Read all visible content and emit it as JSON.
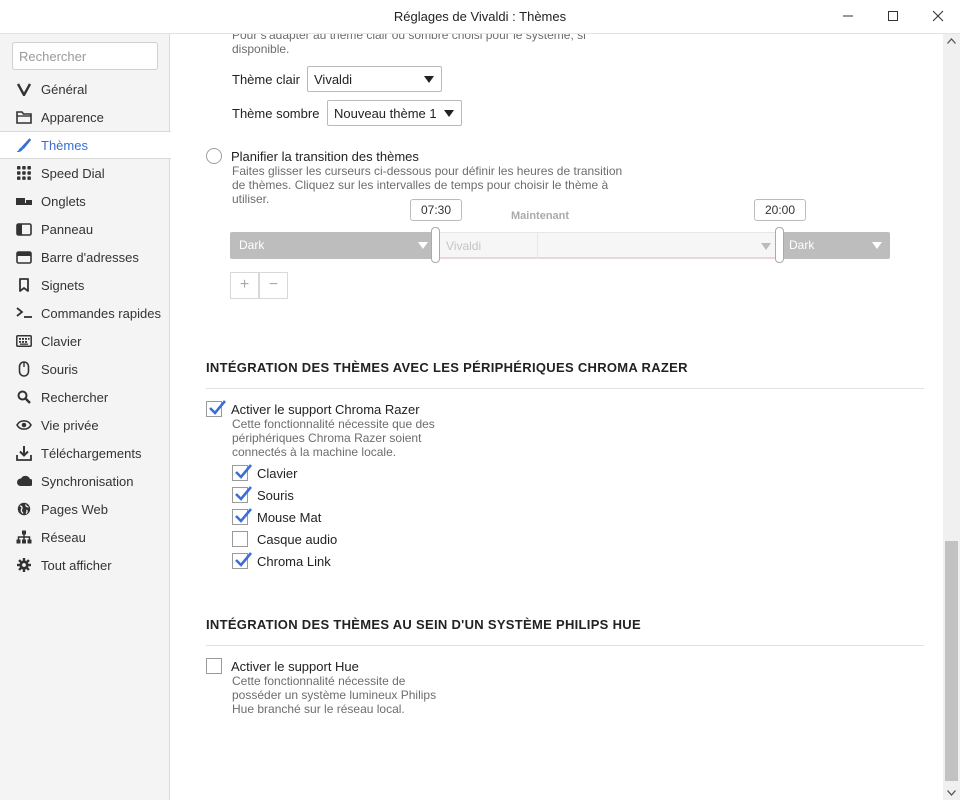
{
  "window": {
    "title": "Réglages de Vivaldi : Thèmes"
  },
  "sidebar": {
    "search_placeholder": "Rechercher",
    "items": [
      {
        "label": "Général",
        "icon": "vivaldi-logo-icon"
      },
      {
        "label": "Apparence",
        "icon": "folder-icon"
      },
      {
        "label": "Thèmes",
        "icon": "brush-icon",
        "active": true
      },
      {
        "label": "Speed Dial",
        "icon": "grid-icon"
      },
      {
        "label": "Onglets",
        "icon": "tabs-icon"
      },
      {
        "label": "Panneau",
        "icon": "panel-icon"
      },
      {
        "label": "Barre d'adresses",
        "icon": "address-bar-icon"
      },
      {
        "label": "Signets",
        "icon": "bookmark-icon"
      },
      {
        "label": "Commandes rapides",
        "icon": "quick-commands-icon"
      },
      {
        "label": "Clavier",
        "icon": "keyboard-icon"
      },
      {
        "label": "Souris",
        "icon": "mouse-icon"
      },
      {
        "label": "Rechercher",
        "icon": "search-icon"
      },
      {
        "label": "Vie privée",
        "icon": "eye-icon"
      },
      {
        "label": "Téléchargements",
        "icon": "download-icon"
      },
      {
        "label": "Synchronisation",
        "icon": "cloud-icon"
      },
      {
        "label": "Pages Web",
        "icon": "globe-icon"
      },
      {
        "label": "Réseau",
        "icon": "network-icon"
      },
      {
        "label": "Tout afficher",
        "icon": "gear-icon"
      }
    ]
  },
  "theme_os": {
    "hint": "Pour s'adapter au thème clair ou sombre choisi pour le système, si disponible.",
    "light_label": "Thème clair",
    "light_value": "Vivaldi",
    "dark_label": "Thème sombre",
    "dark_value": "Nouveau thème 1"
  },
  "schedule": {
    "label": "Planifier la transition des thèmes",
    "hint": "Faites glisser les curseurs ci-dessous pour définir les heures de transition de thèmes. Cliquez sur les intervalles de temps pour choisir le thème à utiliser.",
    "time_start": "07:30",
    "time_end": "20:00",
    "now_label": "Maintenant",
    "segments": [
      "Dark",
      "Vivaldi",
      "Dark"
    ],
    "add_label": "+",
    "remove_label": "−"
  },
  "razer": {
    "title": "INTÉGRATION DES THÈMES AVEC LES PÉRIPHÉRIQUES CHROMA RAZER",
    "enable_label": "Activer le support Chroma Razer",
    "enable_checked": true,
    "hint": "Cette fonctionnalité nécessite que des périphériques Chroma Razer soient connectés à la machine locale.",
    "devices": [
      {
        "label": "Clavier",
        "checked": true
      },
      {
        "label": "Souris",
        "checked": true
      },
      {
        "label": "Mouse Mat",
        "checked": true
      },
      {
        "label": "Casque audio",
        "checked": false
      },
      {
        "label": "Chroma Link",
        "checked": true
      }
    ]
  },
  "hue": {
    "title": "INTÉGRATION DES THÈMES AU SEIN D'UN SYSTÈME PHILIPS HUE",
    "enable_label": "Activer le support Hue",
    "enable_checked": false,
    "hint": "Cette fonctionnalité nécessite de posséder un système lumineux Philips Hue branché sur le réseau local."
  },
  "colors": {
    "accent": "#3b6ed6",
    "track_dark": "#bdbdbd",
    "track_light": "#f2f2f2"
  }
}
